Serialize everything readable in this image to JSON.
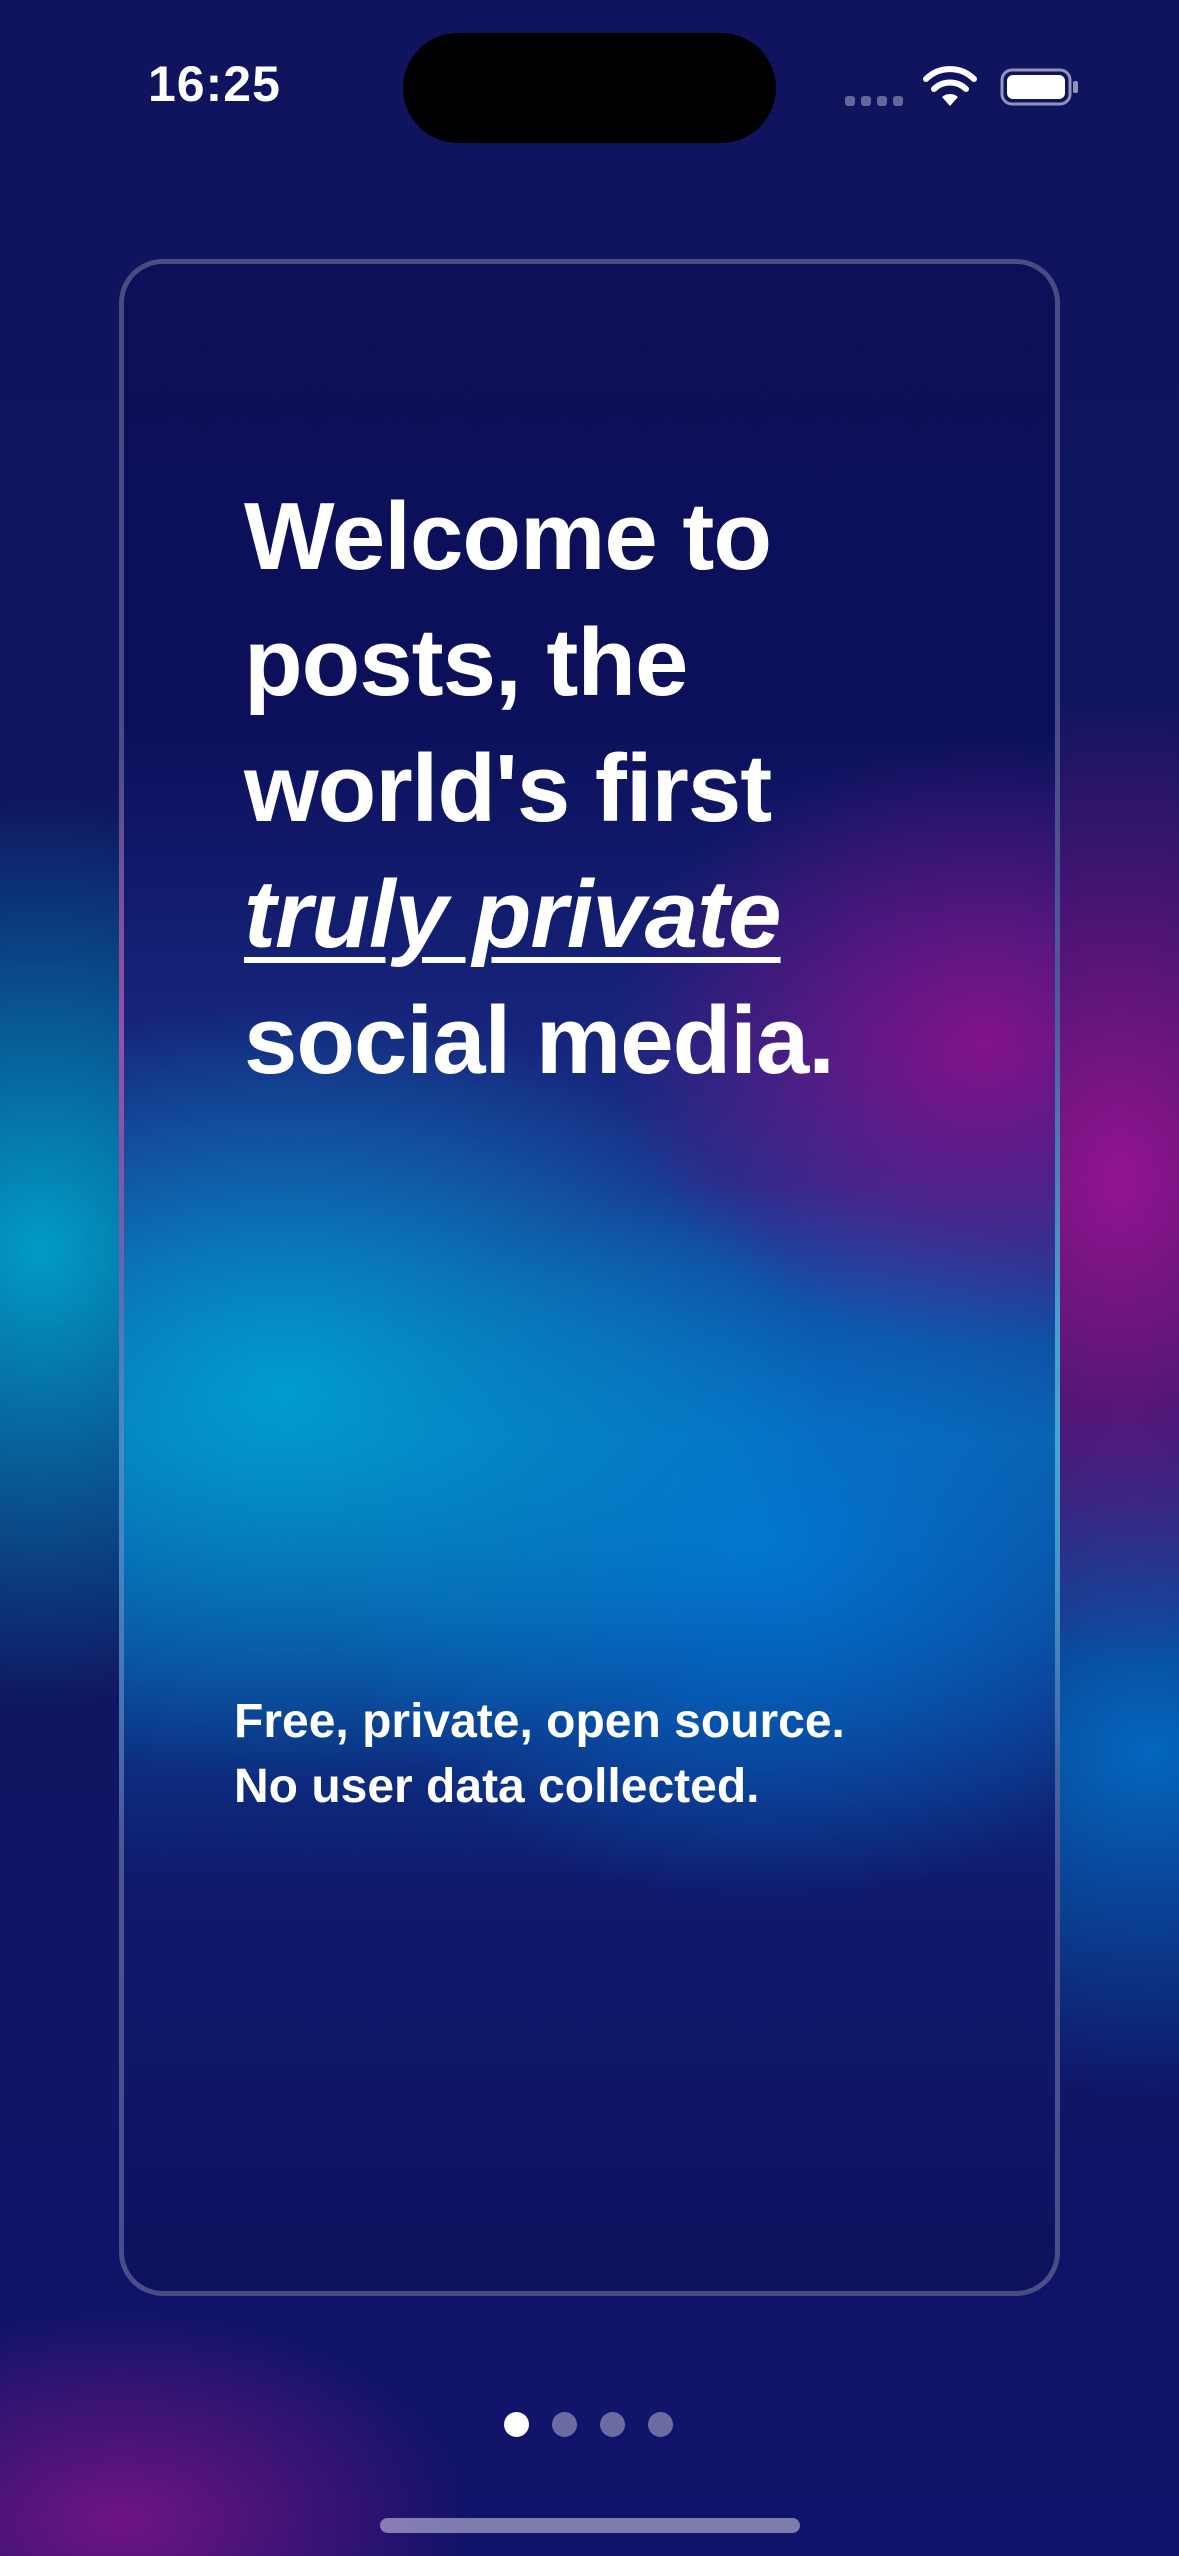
{
  "status_bar": {
    "time": "16:25",
    "icons": [
      "cellular-signal-icon",
      "wifi-icon",
      "battery-icon"
    ]
  },
  "onboarding": {
    "headline": {
      "line1": "Welcome to",
      "line2": "posts, the",
      "line3": "world's first",
      "emphasis": "truly private",
      "line5": "social media."
    },
    "subtext": {
      "line1": "Free, private, open source.",
      "line2": "No user data collected."
    }
  },
  "pagination": {
    "current_page": 1,
    "total_pages": 4
  },
  "colors": {
    "background": "#12125a",
    "accent_magenta": "#a0148c",
    "accent_cyan": "#00a0d2",
    "accent_blue": "#007dd7",
    "text": "#ffffff"
  }
}
